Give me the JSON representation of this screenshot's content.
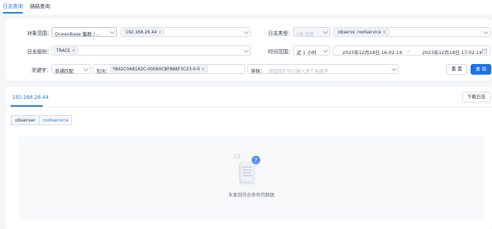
{
  "top_tabs": [
    {
      "label": "日志查询",
      "active": true
    },
    {
      "label": "链路查询",
      "active": false
    }
  ],
  "filters": {
    "scope": {
      "label": "对象范围：",
      "value": "OceanBase 集群 / ...",
      "ip_tag": "192.168.26.44"
    },
    "log_type": {
      "label": "日志类型：",
      "value": "OB 日志",
      "tags": [
        "observer",
        "rootservice"
      ]
    },
    "log_level": {
      "label": "日志级别：",
      "tag": "TRACE"
    },
    "time_range": {
      "label": "时间范围：",
      "preset": "近 1 小时",
      "start": "2023年12月18日 16:02:14",
      "separator": "→",
      "end": "2023年12月18日 17:02:14"
    },
    "keyword": {
      "label": "关键字：",
      "match_mode": "普通匹配",
      "contains_label": "包含：",
      "contains_tag": "Y842C0A81A2C-00060CBF888F3C23-0-0",
      "exclude_label": "排除：",
      "exclude_placeholder": "添加回车可以输入多个关键字"
    },
    "reset_label": "重 置",
    "query_label": "查 询"
  },
  "results": {
    "host_tab": "192.168.26.44",
    "download_label": "下载日志",
    "segments": [
      {
        "label": "observer",
        "active": false
      },
      {
        "label": "rootservice",
        "active": true
      }
    ],
    "empty_text": "未查到符合条件的数据"
  },
  "colors": {
    "accent": "#1b73e8",
    "background": "#f3f5f8"
  },
  "icons": [
    "close-icon",
    "chevron-down-icon",
    "calendar-icon",
    "empty-document-icon"
  ]
}
